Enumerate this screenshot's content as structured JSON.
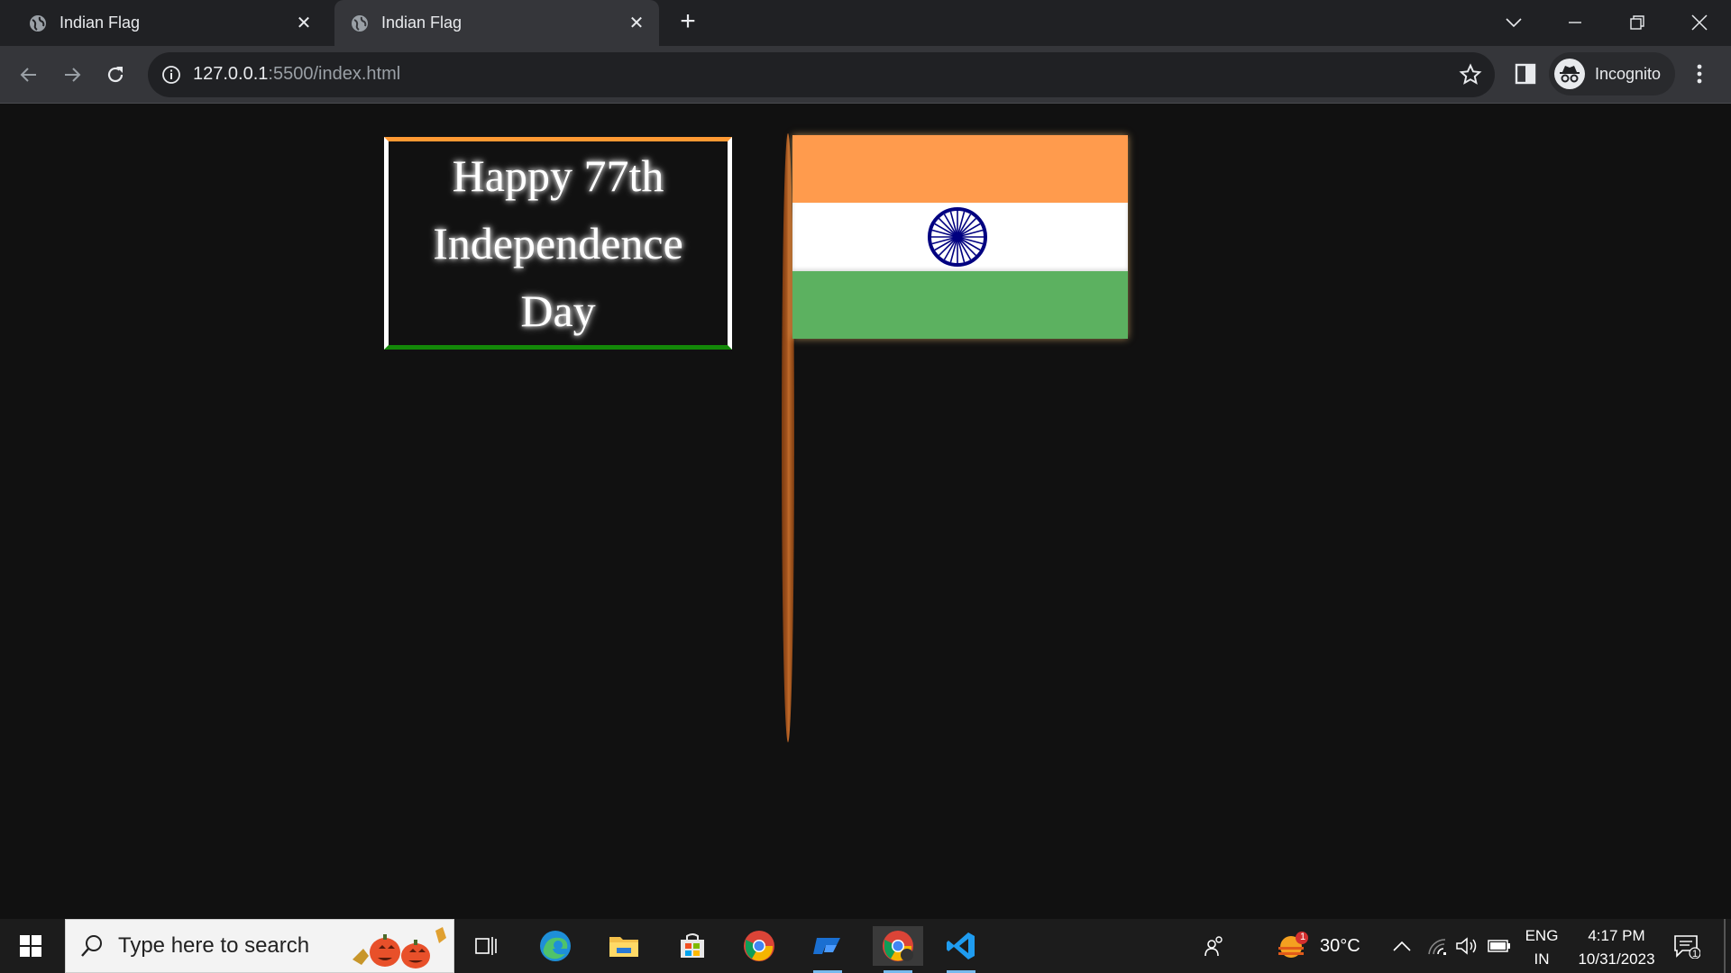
{
  "browser": {
    "tabs": [
      {
        "title": "Indian Flag"
      },
      {
        "title": "Indian Flag"
      }
    ],
    "address": {
      "host": "127.0.0.1",
      "path": ":5500/index.html"
    },
    "profile_label": "Incognito"
  },
  "page": {
    "greeting_lines": [
      "Happy 77th",
      "Independence",
      "Day"
    ],
    "colors": {
      "saffron": "#ff9b4d",
      "white": "#ffffff",
      "green": "#5cb160",
      "chakra": "#000080",
      "pole": "#a0521d"
    }
  },
  "taskbar": {
    "search_placeholder": "Type here to search",
    "weather": "30°C",
    "weather_badge": "1",
    "lang_top": "ENG",
    "lang_bottom": "IN",
    "time": "4:17 PM",
    "date": "10/31/2023",
    "notification_count": "1",
    "pinned_apps": [
      "task-view",
      "edge",
      "file-explorer",
      "microsoft-store",
      "chrome",
      "app",
      "chrome-active",
      "vscode"
    ]
  }
}
